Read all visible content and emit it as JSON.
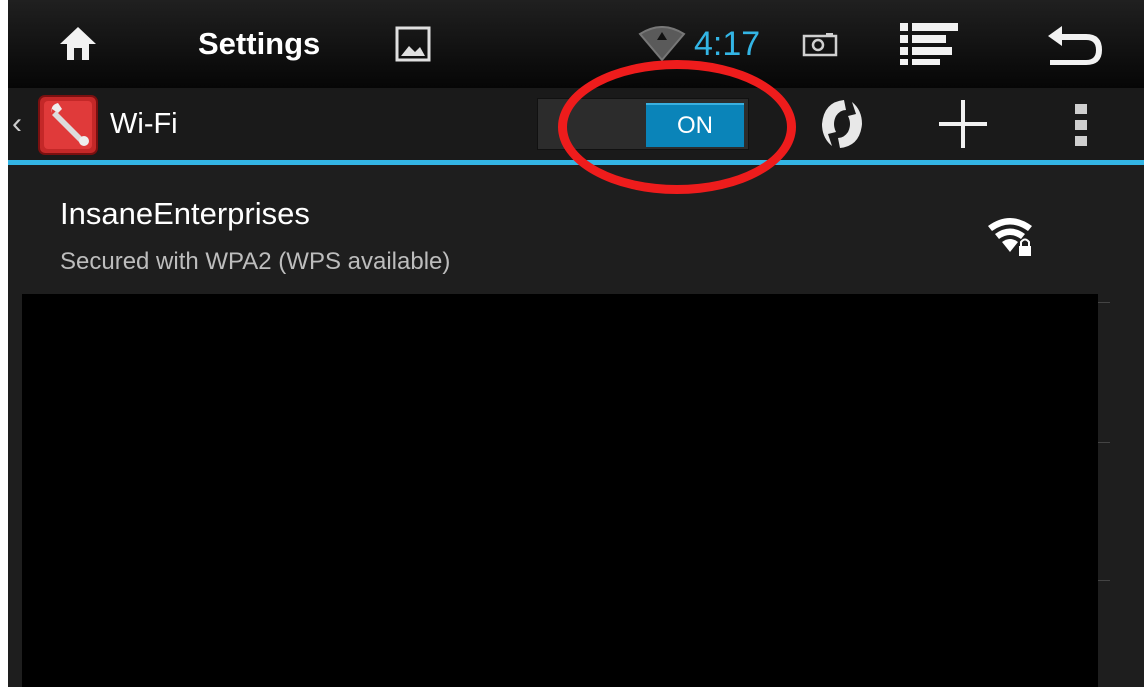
{
  "status_bar": {
    "title": "Settings",
    "time": "4:17",
    "icons": [
      "home-icon",
      "gallery-icon",
      "wifi-status-icon",
      "screenshot-icon",
      "menu-list-icon",
      "back-icon"
    ]
  },
  "action_bar": {
    "title": "Wi-Fi",
    "toggle_label": "ON",
    "icons": [
      "settings-wrench-icon",
      "refresh-icon",
      "add-network-icon",
      "overflow-menu-icon"
    ]
  },
  "networks": [
    {
      "name": "InsaneEnterprises",
      "status": "Secured with WPA2 (WPS available)",
      "icon": "wifi-signal-locked-icon"
    }
  ],
  "colors": {
    "accent": "#33b5e5",
    "toggle_on": "#0a84b9",
    "highlight_ring": "#ee1c1c",
    "background": "#1e1e1e"
  }
}
